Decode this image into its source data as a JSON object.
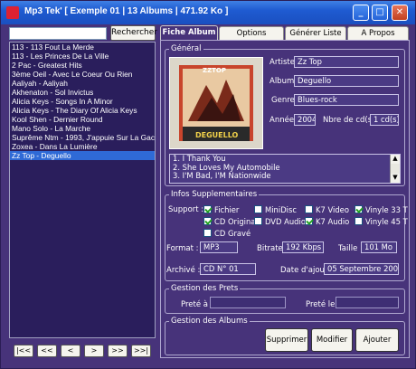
{
  "window": {
    "title": "Mp3 Tek' [ Exemple 01 | 13 Albums | 471.92 Ko ]",
    "minimize": "_",
    "maximize": "□",
    "close": "✕"
  },
  "search": {
    "value": "",
    "button": "Rechercher"
  },
  "albums": [
    "113 - 113 Fout La Merde",
    "113 - Les Princes De La Ville",
    "2 Pac - Greatest Hits",
    "3ème Oeil - Avec Le Coeur Ou Rien",
    "Aaliyah - Aaliyah",
    "Akhenaton - Sol Invictus",
    "Alicia Keys - Songs In A Minor",
    "Alicia Keys - The Diary Of Alicia Keys",
    "Kool Shen - Dernier Round",
    "Mano Solo - La Marche",
    "Suprême Ntm - 1993, J'appuie Sur La Gachet",
    "Zoxea - Dans La Lumière",
    "Zz Top - Deguello"
  ],
  "selected_album_index": 12,
  "nav": [
    "|<<",
    "<<",
    "<",
    ">",
    ">>",
    ">>|"
  ],
  "tabs": [
    "Fiche Album",
    "Options",
    "Générer Liste",
    "A Propos"
  ],
  "general": {
    "legend": "Général",
    "artist_label": "Artiste :",
    "artist": "Zz Top",
    "album_label": "Album :",
    "album": "Deguello",
    "genre_label": "Genre :",
    "genre": "Blues-rock",
    "year_label": "Année :",
    "year": "2004",
    "cds_label": "Nbre de cd(s)",
    "cds": "1 cd(s)",
    "cover_band": "ZZTOP",
    "cover_title": "DEGUELLO",
    "tracks": [
      "1. I Thank You",
      "2. She Loves My Automobile",
      "3. I'M Bad, I'M Nationwide"
    ]
  },
  "extra": {
    "legend": "Infos Supplementaires",
    "support_label": "Support :",
    "supports": [
      {
        "label": "Fichier",
        "checked": true
      },
      {
        "label": "MiniDisc",
        "checked": false
      },
      {
        "label": "K7 Video",
        "checked": false
      },
      {
        "label": "Vinyle 33 T",
        "checked": true
      },
      {
        "label": "CD Original",
        "checked": true
      },
      {
        "label": "DVD Audio",
        "checked": false
      },
      {
        "label": "K7 Audio",
        "checked": true
      },
      {
        "label": "Vinyle 45 T",
        "checked": false
      },
      {
        "label": "CD Gravé",
        "checked": false
      }
    ],
    "format_label": "Format :",
    "format": "MP3",
    "bitrate_label": "Bitrate :",
    "bitrate": "192 Kbps",
    "size_label": "Taille :",
    "size": "101 Mo",
    "archive_label": "Archivé :",
    "archive": "CD N° 01",
    "date_label": "Date d'ajout :",
    "date": "05 Septembre 2004"
  },
  "loans": {
    "legend": "Gestion des Prets",
    "lent_to_label": "Preté à :",
    "lent_to": "",
    "lent_on_label": "Preté le :",
    "lent_on": ""
  },
  "manage": {
    "legend": "Gestion des Albums",
    "delete": "Supprimer",
    "modify": "Modifier",
    "add": "Ajouter"
  }
}
